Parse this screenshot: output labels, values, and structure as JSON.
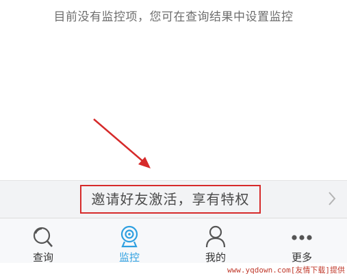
{
  "main": {
    "empty_message": "目前没有监控项，您可在查询结果中设置监控"
  },
  "promo": {
    "text": "邀请好友激活，享有特权",
    "chevron_icon": "chevron-right-icon"
  },
  "tab_bar": {
    "tabs": [
      {
        "label": "查询",
        "icon": "search-icon",
        "active": false
      },
      {
        "label": "监控",
        "icon": "webcam-icon",
        "active": true
      },
      {
        "label": "我的",
        "icon": "user-icon",
        "active": false
      },
      {
        "label": "更多",
        "icon": "more-dots-icon",
        "active": false
      }
    ]
  },
  "watermark": {
    "text": "www.yqdown.com[友情下载]提供"
  },
  "colors": {
    "accent": "#2d9fe0",
    "highlight": "#d62a2a",
    "text": "#333333",
    "muted": "#6d6d6d",
    "promo_bg": "#f2f3f5"
  }
}
